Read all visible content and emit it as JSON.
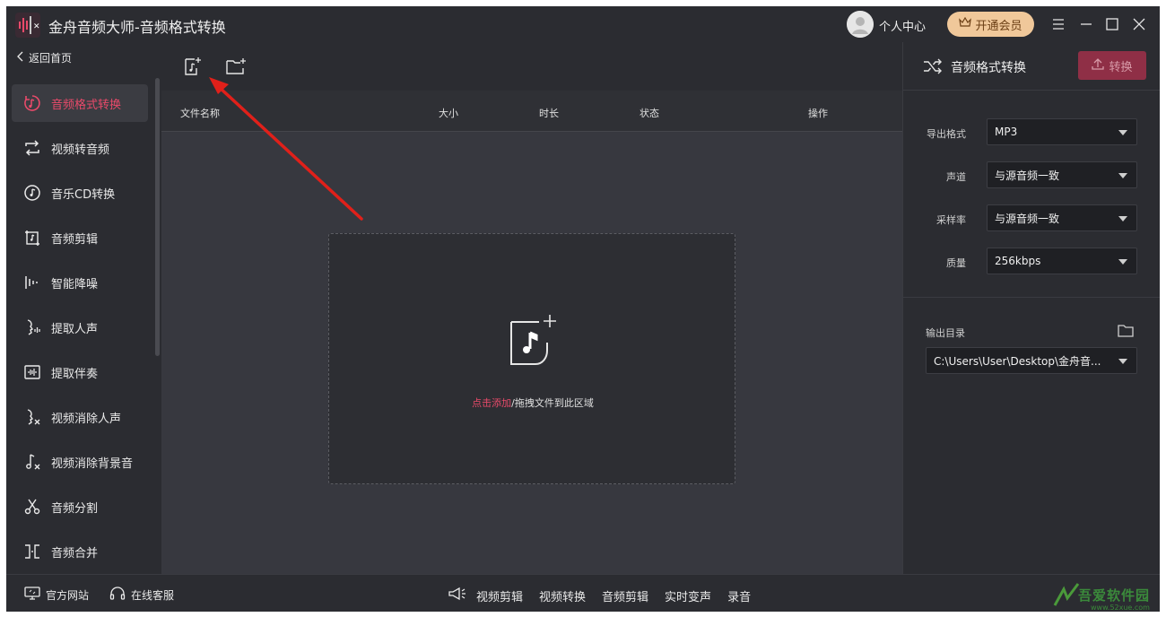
{
  "window": {
    "title": "金舟音频大师-音频格式转换",
    "user_center": "个人中心",
    "vip_label": "开通会员"
  },
  "sidebar": {
    "back_label": "返回首页",
    "items": [
      {
        "label": "音频格式转换",
        "icon": "audio-convert-icon",
        "active": true
      },
      {
        "label": "视频转音频",
        "icon": "video-to-audio-icon"
      },
      {
        "label": "音乐CD转换",
        "icon": "music-cd-icon"
      },
      {
        "label": "音频剪辑",
        "icon": "audio-cut-icon"
      },
      {
        "label": "智能降噪",
        "icon": "denoise-icon"
      },
      {
        "label": "提取人声",
        "icon": "extract-vocal-icon"
      },
      {
        "label": "提取伴奏",
        "icon": "extract-accompaniment-icon"
      },
      {
        "label": "视频消除人声",
        "icon": "remove-vocal-icon"
      },
      {
        "label": "视频消除背景音",
        "icon": "remove-bgm-icon"
      },
      {
        "label": "音频分割",
        "icon": "audio-split-icon"
      },
      {
        "label": "音频合并",
        "icon": "audio-merge-icon"
      }
    ]
  },
  "table": {
    "columns": [
      "文件名称",
      "大小",
      "时长",
      "状态",
      "操作"
    ]
  },
  "dropzone": {
    "link_text": "点击添加",
    "rest_text": "/拖拽文件到此区域"
  },
  "panel": {
    "title": "音频格式转换",
    "convert_label": "转换",
    "fields": [
      {
        "label": "导出格式",
        "value": "MP3"
      },
      {
        "label": "声道",
        "value": "与源音频一致"
      },
      {
        "label": "采样率",
        "value": "与源音频一致"
      },
      {
        "label": "质量",
        "value": "256kbps"
      }
    ],
    "output_label": "输出目录",
    "output_path": "C:\\Users\\User\\Desktop\\金舟音..."
  },
  "bottom": {
    "website": "官方网站",
    "support": "在线客服",
    "links": [
      "视频剪辑",
      "视频转换",
      "音频剪辑",
      "实时变声",
      "录音"
    ]
  },
  "watermark": {
    "text": "吾爱软件园",
    "url": "www.52xue.com"
  },
  "colors": {
    "accent": "#e94a6a",
    "background": "#2b2c31",
    "content_bg": "#37383f",
    "vip": "#f0c89a",
    "annotation_arrow": "#e0201a"
  }
}
